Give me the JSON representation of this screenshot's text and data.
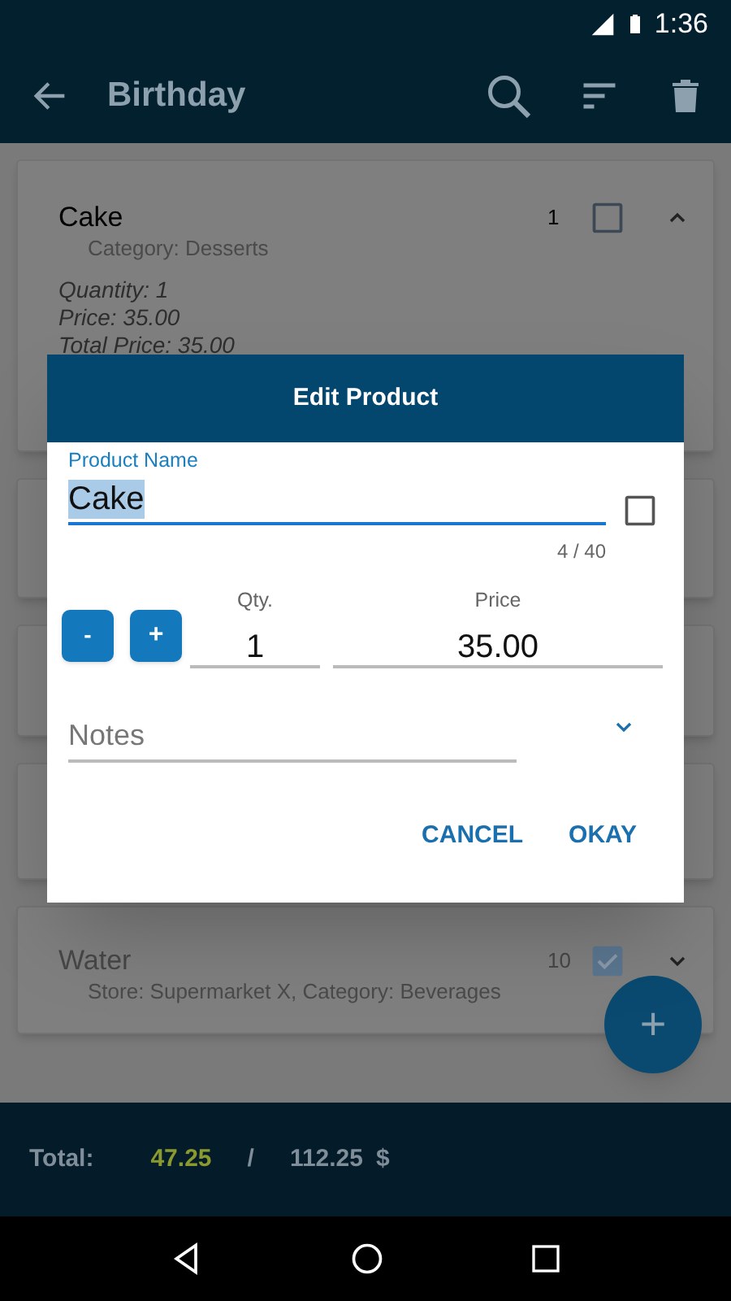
{
  "status_bar": {
    "time": "1:36"
  },
  "app_bar": {
    "title": "Birthday"
  },
  "products": [
    {
      "name": "Cake",
      "count": "1",
      "checked": false,
      "expanded": true,
      "subtitle": "Category: Desserts",
      "details": [
        "Quantity: 1",
        "Price: 35.00",
        "Total Price: 35.00"
      ]
    },
    {
      "name": "Water",
      "count": "10",
      "checked": true,
      "expanded": false,
      "subtitle": "Store: Supermarket X, Category: Beverages"
    }
  ],
  "dialog": {
    "title": "Edit Product",
    "name_label": "Product Name",
    "name_value": "Cake",
    "name_checked": false,
    "counter": "4 / 40",
    "minus": "-",
    "plus": "+",
    "qty_label": "Qty.",
    "qty_value": "1",
    "price_label": "Price",
    "price_value": "35.00",
    "notes_placeholder": "Notes",
    "buttons": [
      "CANCEL",
      "OKAY"
    ]
  },
  "fab": {
    "label": "+"
  },
  "footer": {
    "label": "Total:",
    "checked_total": "47.25",
    "separator": "/",
    "total": "112.25",
    "currency": "$"
  }
}
